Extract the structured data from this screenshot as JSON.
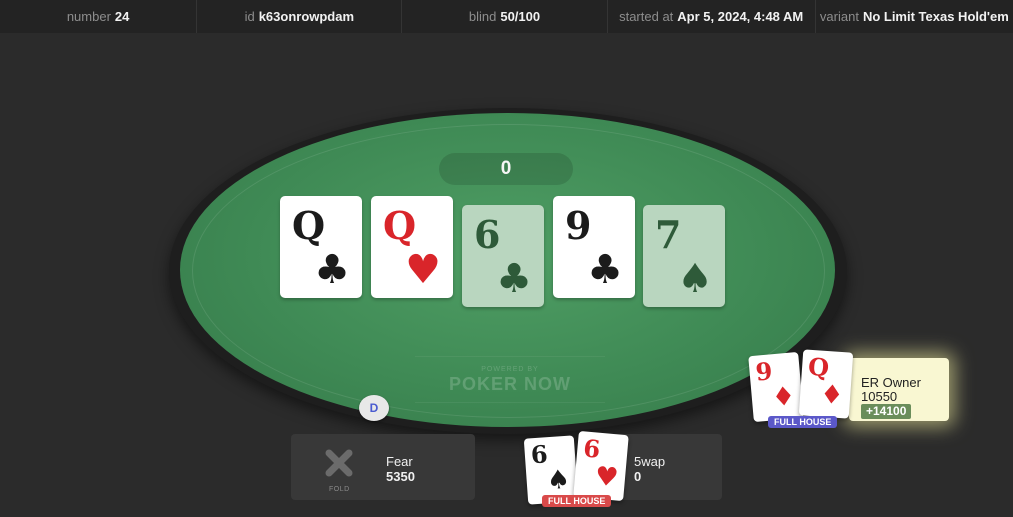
{
  "header": {
    "number_label": "number",
    "number_value": "24",
    "id_label": "id",
    "id_value": "k63onrowpdam",
    "blind_label": "blind",
    "blind_value": "50/100",
    "started_label": "started at",
    "started_value": "Apr 5, 2024, 4:48 AM",
    "variant_label": "variant",
    "variant_value": "No Limit Texas Hold'em"
  },
  "pot": "0",
  "board": [
    {
      "rank": "Q",
      "suit": "♣",
      "color": "black",
      "highlighted": true
    },
    {
      "rank": "Q",
      "suit": "♥",
      "color": "red",
      "highlighted": true
    },
    {
      "rank": "6",
      "suit": "♣",
      "color": "black",
      "highlighted": false
    },
    {
      "rank": "9",
      "suit": "♣",
      "color": "black",
      "highlighted": true
    },
    {
      "rank": "7",
      "suit": "♠",
      "color": "black",
      "highlighted": false
    }
  ],
  "brand": {
    "small": "POWERED BY",
    "big": "POKER NOW"
  },
  "dealer_button": "D",
  "players": {
    "fear": {
      "name": "Fear",
      "stack": "5350",
      "status": "FOLD"
    },
    "swap": {
      "name": "5wap",
      "stack": "0",
      "hand_label": "FULL HOUSE",
      "cards": [
        {
          "rank": "6",
          "suit": "♠"
        },
        {
          "rank": "6",
          "suit": "♥"
        }
      ]
    },
    "owner": {
      "name": "ER Owner",
      "stack": "10550",
      "delta": "+14100",
      "hand_label": "FULL HOUSE",
      "cards": [
        {
          "rank": "9",
          "suit": "♦"
        },
        {
          "rank": "Q",
          "suit": "♦"
        }
      ]
    }
  },
  "colors": {
    "felt": "#3f8a55",
    "red_suit": "#d9252a",
    "winner_highlight": "#f9f7d2"
  }
}
